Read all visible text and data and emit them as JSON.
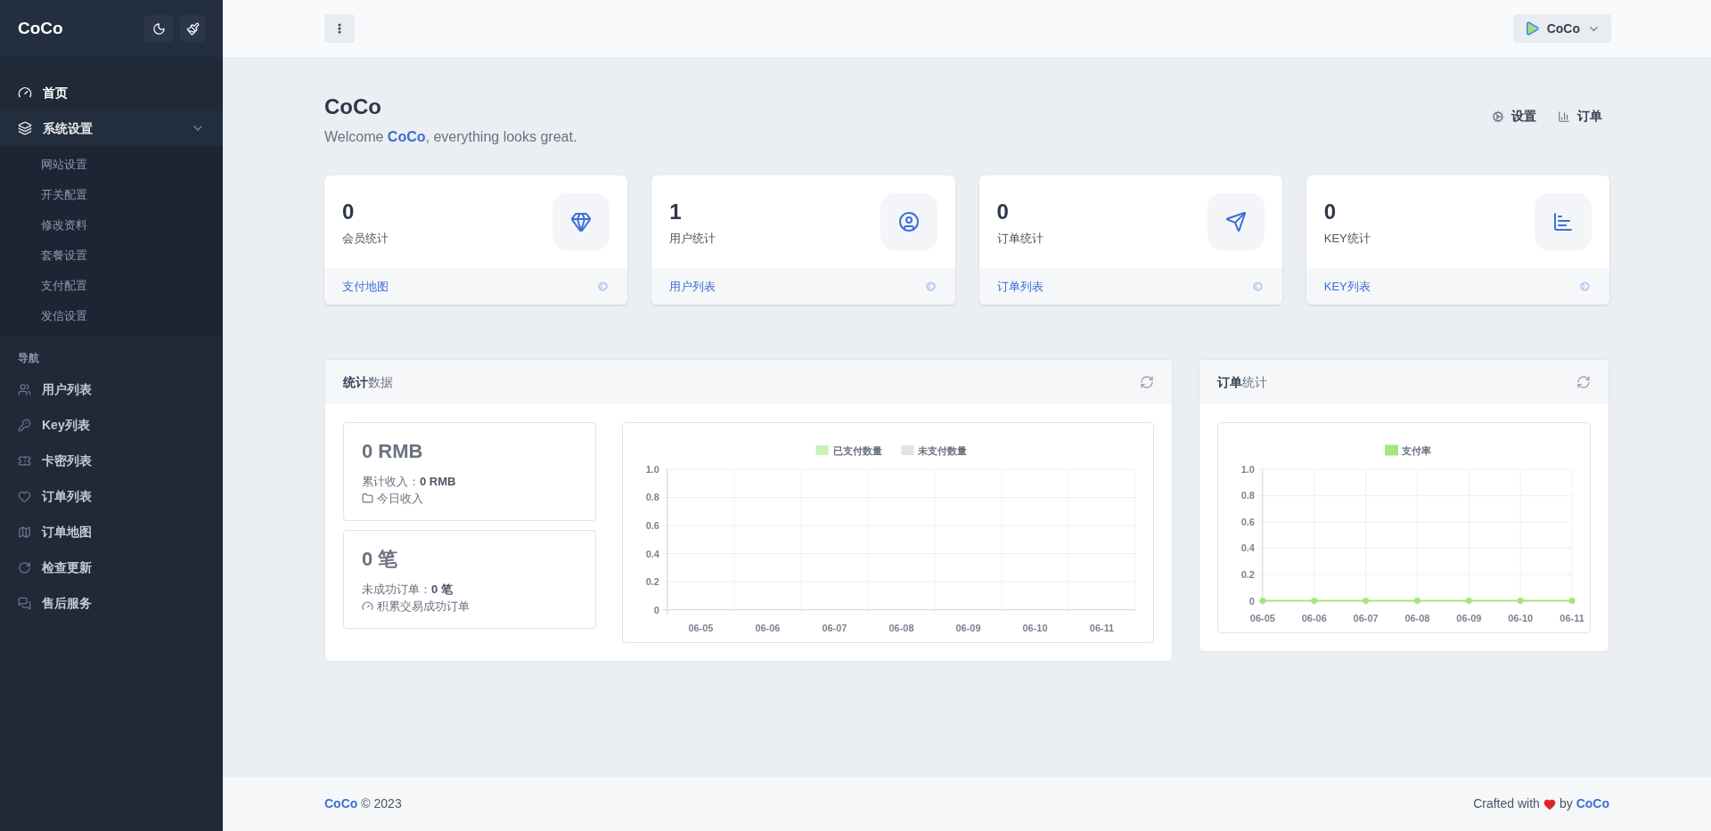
{
  "sidebar": {
    "brand": "CoCo",
    "menu": [
      {
        "label": "首页",
        "selected": true
      },
      {
        "label": "系统设置",
        "selected": false,
        "expanded": true,
        "children": [
          {
            "label": "网站设置"
          },
          {
            "label": "开关配置"
          },
          {
            "label": "修改资料"
          },
          {
            "label": "套餐设置"
          },
          {
            "label": "支付配置"
          },
          {
            "label": "发信设置"
          }
        ]
      }
    ],
    "section_title": "导航",
    "nav": [
      {
        "label": "用户列表"
      },
      {
        "label": "Key列表"
      },
      {
        "label": "卡密列表"
      },
      {
        "label": "订单列表"
      },
      {
        "label": "订单地图"
      },
      {
        "label": "检查更新"
      },
      {
        "label": "售后服务"
      }
    ]
  },
  "topbar": {
    "user": "CoCo"
  },
  "page": {
    "title": "CoCo",
    "welcome_prefix": "Welcome",
    "welcome_link": "CoCo",
    "welcome_suffix": ", everything looks great.",
    "actions": [
      "设置",
      "订单"
    ]
  },
  "stat_cards": [
    {
      "value": "0",
      "label": "会员统计",
      "link": "支付地图"
    },
    {
      "value": "1",
      "label": "用户统计",
      "link": "用户列表"
    },
    {
      "value": "0",
      "label": "订单统计",
      "link": "订单列表"
    },
    {
      "value": "0",
      "label": "KEY统计",
      "link": "KEY列表"
    }
  ],
  "stats_panel": {
    "title": "**统计**数据",
    "boxes": [
      {
        "value": "0 RMB",
        "detail": "累计收入：**0 RMB**",
        "note": "今日收入"
      },
      {
        "value": "0 笔",
        "detail": "未成功订单：**0 笔**",
        "note": "积累交易成功订单"
      }
    ],
    "chart_data": {
      "type": "bar",
      "grid": true,
      "categories": [
        "06-05",
        "06-06",
        "06-07",
        "06-08",
        "06-09",
        "06-10",
        "06-11"
      ],
      "ylim": [
        0,
        1
      ],
      "yticks": [
        0,
        0.2,
        0.4,
        0.6,
        0.8,
        {
          "value": 1,
          "label": "1.0"
        }
      ],
      "series": [
        {
          "name": "已支付数量",
          "color": "#cdefb9",
          "values": [
            0,
            0,
            0,
            0,
            0,
            0,
            0
          ]
        },
        {
          "name": "未支付数量",
          "color": "#e4e4e4",
          "values": [
            0,
            0,
            0,
            0,
            0,
            0,
            0
          ]
        }
      ]
    }
  },
  "orders_panel": {
    "title": "**订单**统计",
    "chart_data": {
      "type": "line",
      "grid": true,
      "categories": [
        "06-05",
        "06-06",
        "06-07",
        "06-08",
        "06-09",
        "06-10",
        "06-11"
      ],
      "ylim": [
        0,
        1
      ],
      "yticks": [
        0,
        0.2,
        0.4,
        0.6,
        0.8,
        {
          "value": 1,
          "label": "1.0"
        }
      ],
      "series": [
        {
          "name": "支付率",
          "color": "#a6e47c",
          "marker": true,
          "values": [
            0,
            0,
            0,
            0,
            0,
            0,
            0
          ]
        }
      ]
    }
  },
  "footer": {
    "left_link": "CoCo",
    "left_text": "© 2023",
    "right_prefix": "Crafted with",
    "right_middle": "by",
    "right_link": "CoCo"
  }
}
